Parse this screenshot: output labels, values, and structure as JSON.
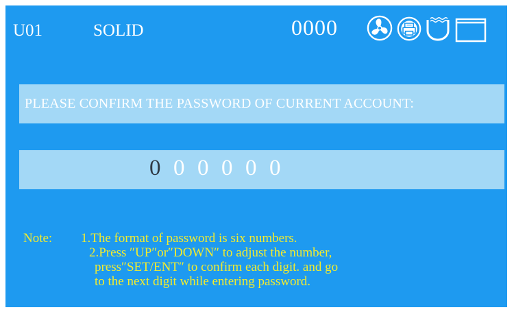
{
  "header": {
    "user_code": "U01",
    "mode": "SOLID",
    "counter": "0000",
    "icons": [
      "fan-icon",
      "printer-icon",
      "bath-icon",
      "window-icon"
    ]
  },
  "prompt": {
    "text": "PLEASE CONFIRM THE PASSWORD OF CURRENT ACCOUNT:"
  },
  "password": {
    "digits": [
      "0",
      "0",
      "0",
      "0",
      "0",
      "0"
    ],
    "active_index": 0
  },
  "note": {
    "label": "Note:",
    "line1": "1.The format of password is six numbers.",
    "line2": "2.Press ″UP″or″DOWN″ to adjust the number,",
    "line3": "press″SET/ENT″ to confirm each digit. and go",
    "line4": "to the next digit while entering password."
  },
  "colors": {
    "background": "#1e9af0",
    "panel": "#a3d8f6",
    "note_text": "#f2ec2e",
    "active_digit": "#2f3a45"
  }
}
